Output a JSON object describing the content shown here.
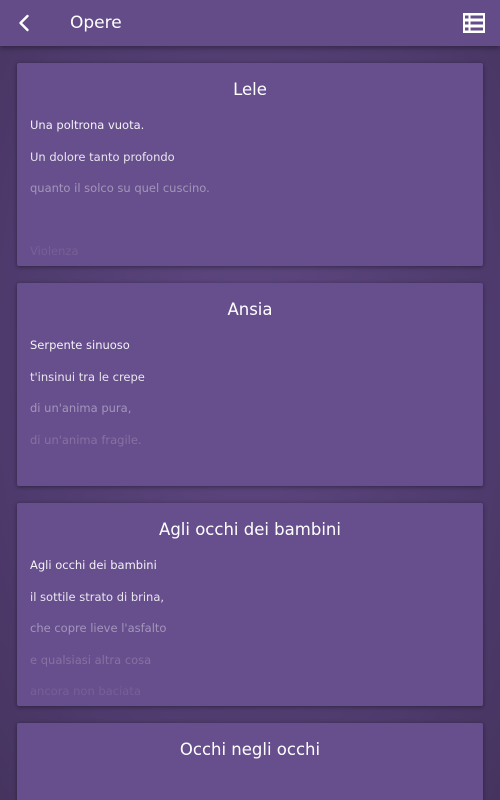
{
  "appbar": {
    "title": "Opere",
    "back_icon": "chevron-left-icon",
    "menu_icon": "list-view-icon"
  },
  "colors": {
    "appbar": "#634c88",
    "card": "#674e8c",
    "background": "#4e3a6c",
    "text": "#ffffff"
  },
  "poems": [
    {
      "title": "Lele",
      "lines": [
        "Una poltrona vuota.",
        "Un dolore tanto profondo",
        "quanto il solco su quel cuscino.",
        "",
        "Violenza"
      ]
    },
    {
      "title": "Ansia",
      "lines": [
        "Serpente sinuoso",
        "t'insinui tra le crepe",
        "di un'anima pura,",
        "di un'anima fragile.",
        ""
      ]
    },
    {
      "title": "Agli occhi dei bambini",
      "lines": [
        "Agli occhi dei bambini",
        "il sottile strato di brina,",
        "che copre lieve l'asfalto",
        "e qualsiasi altra cosa",
        "ancora non baciata"
      ]
    },
    {
      "title": "Occhi negli occhi",
      "lines": []
    }
  ]
}
